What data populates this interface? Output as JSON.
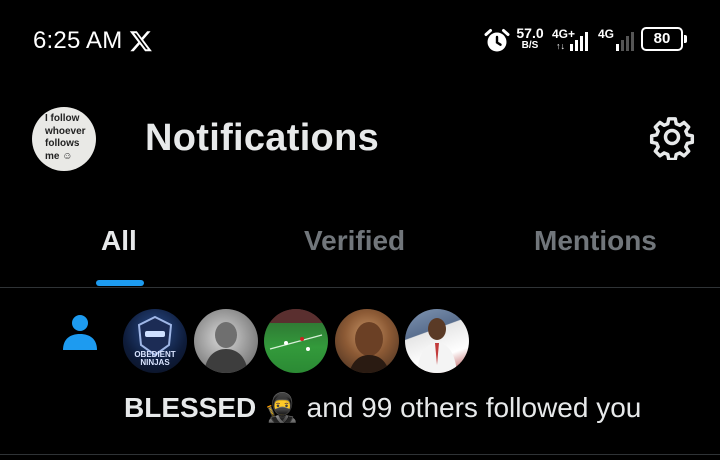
{
  "status_bar": {
    "time": "6:25 AM",
    "speed_value": "57.0",
    "speed_unit": "B/S",
    "network_1": "4G+",
    "network_1_arrows": "↑↓",
    "network_2": "4G",
    "battery_percent": "80",
    "icons": [
      "x-logo-icon",
      "alarm-icon",
      "signal-icon",
      "battery-icon"
    ]
  },
  "header": {
    "avatar_text": "I follow\nwhoever\nfollows\nme ☺",
    "title": "Notifications",
    "settings_icon": "gear-icon"
  },
  "tabs": [
    {
      "label": "All",
      "active": true
    },
    {
      "label": "Verified",
      "active": false
    },
    {
      "label": "Mentions",
      "active": false
    }
  ],
  "notification": {
    "icon": "person-icon",
    "follower_avatars": [
      "OBEDIENT NINJAS",
      "",
      "",
      "",
      ""
    ],
    "name": "BLESSED",
    "emoji": "🥷",
    "message": " and 99 others followed you"
  },
  "colors": {
    "background": "#000000",
    "text": "#e7e9ea",
    "muted": "#71767b",
    "accent": "#1d9bf0",
    "divider": "#2f3336"
  }
}
